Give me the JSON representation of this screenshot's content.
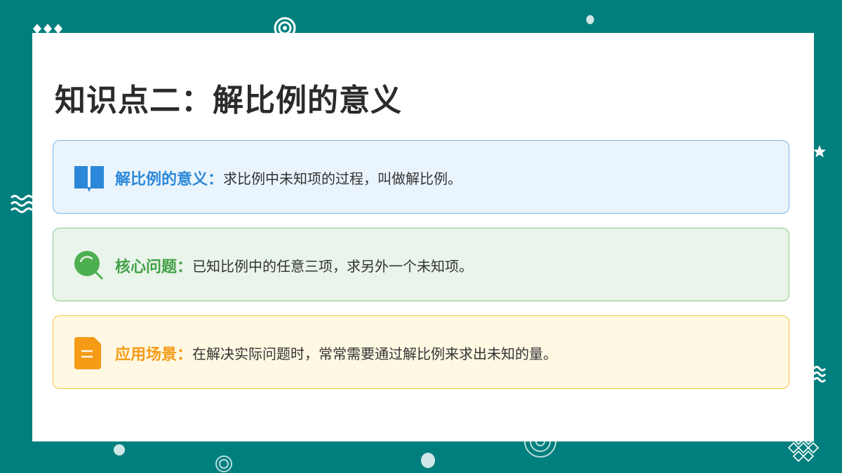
{
  "page": {
    "title": "知识点二：解比例的意义"
  },
  "cards": [
    {
      "icon": "book-icon",
      "label": "解比例的意义：",
      "text": "求比例中未知项的过程，叫做解比例。",
      "accent": "#2b88d8",
      "background": "#eaf4fd",
      "border": "#7fb4e4"
    },
    {
      "icon": "magnifier-icon",
      "label": "核心问题：",
      "text": "已知比例中的任意三项，求另外一个未知项。",
      "accent": "#43a047",
      "background": "#e9f4ea",
      "border": "#8cc98f"
    },
    {
      "icon": "document-icon",
      "label": "应用场景：",
      "text": "在解决实际问题时，常常需要通过解比例来求出未知的量。",
      "accent": "#f59b16",
      "background": "#fff8e3",
      "border": "#f4c542"
    }
  ],
  "colors": {
    "background": "#007f7e",
    "slide": "#ffffff",
    "title": "#2b2b2b"
  }
}
